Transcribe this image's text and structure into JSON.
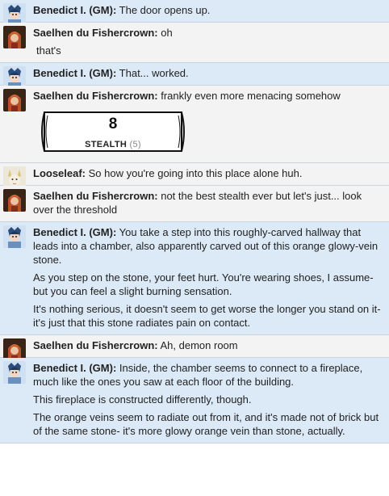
{
  "messages": [
    {
      "speaker": "Benedict I. (GM):",
      "type": "gm",
      "avatar": "gm-avatar-icon",
      "lines": [
        "The door opens up."
      ]
    },
    {
      "speaker": "Saelhen du Fishercrown:",
      "type": "pc",
      "avatar": "saelhen-avatar-icon",
      "lines": [
        "oh"
      ],
      "continuation": [
        "that's"
      ]
    },
    {
      "speaker": "Benedict I. (GM):",
      "type": "gm",
      "avatar": "gm-avatar-icon",
      "lines": [
        "That... worked."
      ]
    },
    {
      "speaker": "Saelhen du Fishercrown:",
      "type": "pc",
      "avatar": "saelhen-avatar-icon",
      "lines": [
        "frankly even more menacing somehow"
      ],
      "roll": {
        "value": "8",
        "label": "STEALTH",
        "modifier": "(5)"
      }
    },
    {
      "speaker": "Looseleaf:",
      "type": "pc",
      "avatar": "looseleaf-avatar-icon",
      "lines": [
        "So how you're going into this place alone huh."
      ]
    },
    {
      "speaker": "Saelhen du Fishercrown:",
      "type": "pc",
      "avatar": "saelhen-avatar-icon",
      "lines": [
        "not the best stealth ever but let's just... look over the threshold"
      ]
    },
    {
      "speaker": "Benedict I. (GM):",
      "type": "gm",
      "avatar": "gm-avatar-icon",
      "lines": [
        "You take a step into this roughly-carved hallway that leads into a chamber, also apparently carved out of this orange glowy-vein stone.",
        "As you step on the stone, your feet hurt. You're wearing shoes, I assume- but you can feel a slight burning sensation.",
        "It's nothing serious, it doesn't seem to get worse the longer you stand on it- it's just that this stone radiates pain on contact."
      ]
    },
    {
      "speaker": "Saelhen du Fishercrown:",
      "type": "pc",
      "avatar": "saelhen-avatar-icon",
      "lines": [
        "Ah, demon room"
      ]
    },
    {
      "speaker": "Benedict I. (GM):",
      "type": "gm",
      "avatar": "gm-avatar-icon",
      "lines": [
        "Inside, the chamber seems to connect to a fireplace, much like the ones you saw at each floor of the building.",
        "This fireplace is constructed differently, though.",
        "The orange veins seem to radiate out from it, and it's made not of brick but of the same stone- it's more glowy orange vein than stone, actually."
      ]
    }
  ],
  "colors": {
    "gm_bg": "#dce9f7",
    "pc_bg": "#f3f3f3"
  }
}
